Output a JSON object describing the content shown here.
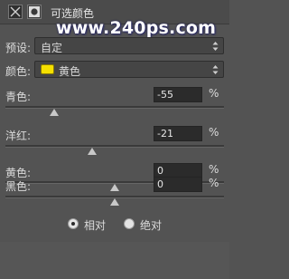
{
  "header": {
    "title": "可选颜色"
  },
  "watermark": "www.240ps.com",
  "preset": {
    "label": "预设:",
    "value": "自定"
  },
  "colors": {
    "label": "颜色:",
    "value": "黄色",
    "swatch_color": "#f5e000"
  },
  "sliders": [
    {
      "label": "青色:",
      "value": "-55",
      "unit": "%",
      "level": -55
    },
    {
      "label": "洋红:",
      "value": "-21",
      "unit": "%",
      "level": -21
    },
    {
      "label": "黄色:",
      "value": "0",
      "unit": "%",
      "level": 0
    },
    {
      "label": "黑色:",
      "value": "0",
      "unit": "%",
      "level": 0
    }
  ],
  "method": {
    "options": [
      {
        "label": "相对",
        "selected": true
      },
      {
        "label": "绝对",
        "selected": false
      }
    ]
  }
}
